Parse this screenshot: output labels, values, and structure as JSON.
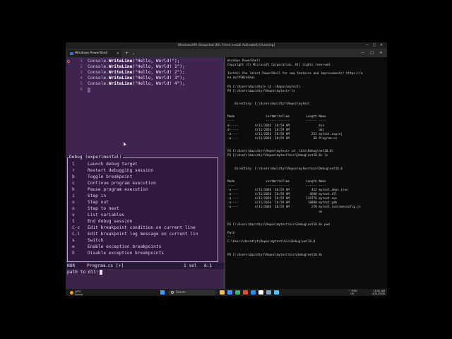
{
  "window": {
    "title": "WindowsVM (Snapshot 001 Fresh Install Activated) [Running]",
    "controls": [
      "—",
      "□",
      "✕"
    ]
  },
  "tabbar": {
    "tab_label": "Windows PowerShell",
    "tab_close": "✕",
    "new_tab": "+",
    "dropdown": "⌄",
    "min": "—",
    "max": "□",
    "close": "✕"
  },
  "editor": {
    "lines": [
      {
        "num": "1",
        "pre": "Console.",
        "kw": "WriteLine",
        "arg": "(\"Hello, World!\");"
      },
      {
        "num": "2",
        "pre": "Console.",
        "kw": "WriteLine",
        "arg": "(\"Hello, World! 1\");"
      },
      {
        "num": "3",
        "pre": "Console.",
        "kw": "WriteLine",
        "arg": "(\"Hello, World! 2\");"
      },
      {
        "num": "4",
        "pre": "Console.",
        "kw": "WriteLine",
        "arg": "(\"Hello, World! 3\");"
      },
      {
        "num": "5",
        "pre": "Console.",
        "kw": "WriteLine",
        "arg": "(\"Hello, World! 4\");"
      },
      {
        "num": "6",
        "pre": "",
        "kw": "",
        "arg": ""
      }
    ]
  },
  "debug_menu": {
    "title": "Debug (experimental)",
    "items": [
      {
        "key": "l",
        "label": "Launch debug target"
      },
      {
        "key": "r",
        "label": "Restart debugging session"
      },
      {
        "key": "b",
        "label": "Toggle breakpoint"
      },
      {
        "key": "c",
        "label": "Continue program execution"
      },
      {
        "key": "h",
        "label": "Pause program execution"
      },
      {
        "key": "i",
        "label": "Step in"
      },
      {
        "key": "o",
        "label": "Step out"
      },
      {
        "key": "n",
        "label": "Step to next"
      },
      {
        "key": "v",
        "label": "List variables"
      },
      {
        "key": "t",
        "label": "End debug session"
      },
      {
        "key": "C-c",
        "label": "Edit breakpoint condition on current line"
      },
      {
        "key": "C-l",
        "label": "Edit breakpoint log message on current lin"
      },
      {
        "key": "s",
        "label": "Switch"
      },
      {
        "key": "e",
        "label": "Enable exception breakpoints"
      },
      {
        "key": "E",
        "label": "Disable exception breakpoints"
      }
    ]
  },
  "statusbar": {
    "mode": "NOR",
    "file": "Program.cs [+]",
    "selections": "1 sel",
    "position": "6:1"
  },
  "cmdline": {
    "prompt": "path to dll:"
  },
  "terminal": {
    "lines": [
      "Windows PowerShell",
      "Copyright (C) Microsoft Corporation. All rights reserved.",
      "",
      "Install the latest PowerShell for new features and improvements! https://a",
      "ka.ms/PSWindows",
      "",
      "PS C:\\Users\\davidtyt> cd .\\Repos\\mytest\\",
      "PS C:\\Users\\davidtyt\\Repos\\mytest> ls",
      "",
      "",
      "    Directory: C:\\Users\\davidtyt\\Repos\\mytest",
      "",
      "",
      "Mode                 LastWriteTime         Length Name",
      "----                 -------------         ------ ----",
      "d-----         4/11/2026  10:59 AM                bin",
      "d-----         4/11/2026  10:59 AM                obj",
      "-a----         4/11/2026  10:59 AM            253 mytest.csproj",
      "-a----         4/11/2026  10:59 AM             60 Program.cs",
      "",
      "",
      "PS C:\\Users\\davidtyt\\Repos\\mytest> cd .\\bin\\Debug\\net10.0\\",
      "PS C:\\Users\\davidtyt\\Repos\\mytest\\bin\\Debug\\net10.0> ls",
      "",
      "",
      "    Directory: C:\\Users\\davidtyt\\Repos\\mytest\\bin\\Debug\\net10.0",
      "",
      "",
      "Mode                 LastWriteTime         Length Name",
      "----                 -------------         ------ ----",
      "-a----         4/11/2026  10:59 AM            412 mytest.deps.json",
      "-a----         4/11/2026  10:59 AM           4608 mytest.dll",
      "-a----         4/11/2026  10:59 AM         139776 mytest.exe",
      "-a----         4/11/2026  10:59 AM          10800 mytest.pdb",
      "-a----         4/11/2026  10:59 AM            270 mytest.runtimeconfig.js",
      "                                                  on",
      "",
      "",
      "PS C:\\Users\\davidtyt\\Repos\\mytest\\bin\\Debug\\net10.0> pwd",
      "",
      "Path",
      "----",
      "C:\\Users\\davidtyt\\Repos\\mytest\\bin\\Debug\\net10.0",
      "",
      "",
      "PS C:\\Users\\davidtyt\\Repos\\mytest\\bin\\Debug\\net10.0>"
    ]
  },
  "taskbar": {
    "weather_temp": "29°C",
    "weather_desc": "Sunny",
    "search_placeholder": "Search",
    "tray": "^  ENG\n   US",
    "time": "11:00 AM",
    "date": "4/11/2026",
    "colors": {
      "start": "#3aa0ff",
      "icons": [
        "#f2c14e",
        "#4a8cff",
        "#2bb673",
        "#e04e39",
        "#1e90ff",
        "#ffffff",
        "#7aa6c2",
        "#4fc3f7"
      ]
    }
  }
}
